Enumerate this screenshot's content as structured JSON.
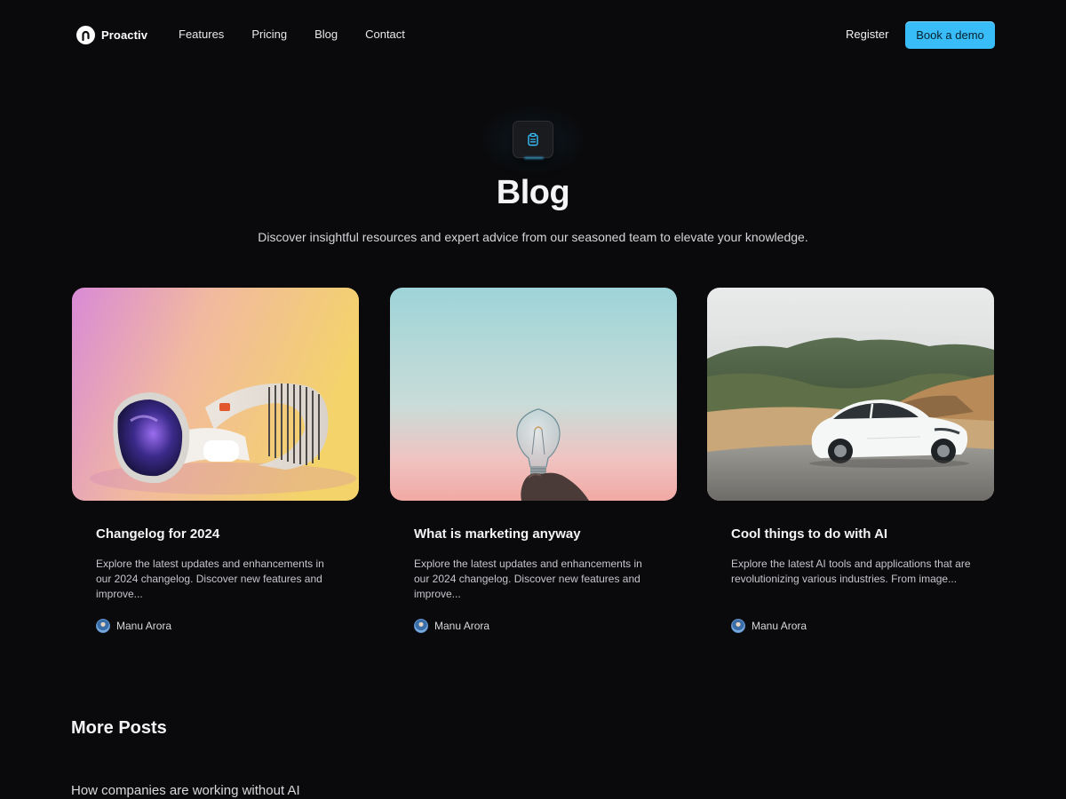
{
  "nav": {
    "brand": "Proactiv",
    "links": [
      "Features",
      "Pricing",
      "Blog",
      "Contact"
    ],
    "register": "Register",
    "cta": "Book a demo"
  },
  "hero": {
    "icon": "clipboard-icon",
    "title": "Blog",
    "subtitle": "Discover insightful resources and expert advice from our seasoned team to elevate your knowledge."
  },
  "posts": [
    {
      "title": "Changelog for 2024",
      "description": "Explore the latest updates and enhancements in our 2024 changelog. Discover new features and improve...",
      "author": "Manu Arora",
      "image": "vr-headset-image"
    },
    {
      "title": "What is marketing anyway",
      "description": "Explore the latest updates and enhancements in our 2024 changelog. Discover new features and improve...",
      "author": "Manu Arora",
      "image": "lightbulb-image"
    },
    {
      "title": "Cool things to do with AI",
      "description": "Explore the latest AI tools and applications that are revolutionizing various industries. From image...",
      "author": "Manu Arora",
      "image": "white-car-image"
    }
  ],
  "more": {
    "title": "More Posts",
    "posts": [
      "How companies are working without AI"
    ]
  },
  "colors": {
    "background": "#0a0a0c",
    "accent": "#38bdf8"
  }
}
